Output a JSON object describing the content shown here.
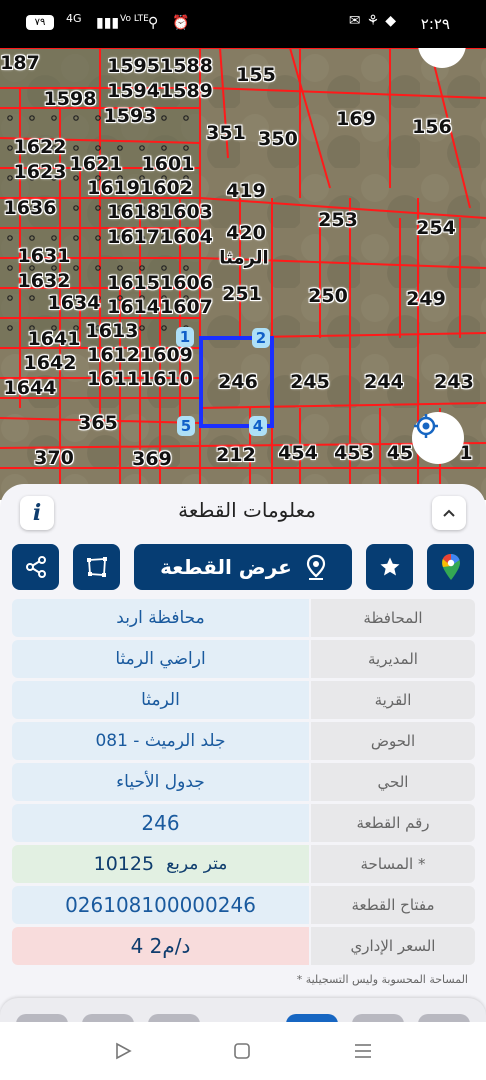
{
  "status_bar": {
    "time": "٢:٢٩",
    "battery": "٧٩",
    "network_top": "4G",
    "network_bottom": "Vo LTE"
  },
  "map": {
    "town_label": "الرمثا",
    "selected_parcel": "246",
    "parcels": [
      {
        "label": "15951588"
      },
      {
        "label": "15941589"
      },
      {
        "label": "1593"
      },
      {
        "label": "1598"
      },
      {
        "label": "1622"
      },
      {
        "label": "1621"
      },
      {
        "label": "1601"
      },
      {
        "label": "1623"
      },
      {
        "label": "16191602"
      },
      {
        "label": "1636"
      },
      {
        "label": "16181603"
      },
      {
        "label": "16171604"
      },
      {
        "label": "1631"
      },
      {
        "label": "1632"
      },
      {
        "label": "16151606"
      },
      {
        "label": "1634"
      },
      {
        "label": "16141607"
      },
      {
        "label": "1613"
      },
      {
        "label": "1641"
      },
      {
        "label": "16121609"
      },
      {
        "label": "1642"
      },
      {
        "label": "16111610"
      },
      {
        "label": "1644"
      },
      {
        "label": "155"
      },
      {
        "label": "169"
      },
      {
        "label": "156"
      },
      {
        "label": "351"
      },
      {
        "label": "350"
      },
      {
        "label": "419"
      },
      {
        "label": "253"
      },
      {
        "label": "254"
      },
      {
        "label": "420"
      },
      {
        "label": "251"
      },
      {
        "label": "250"
      },
      {
        "label": "249"
      },
      {
        "label": "246"
      },
      {
        "label": "245"
      },
      {
        "label": "244"
      },
      {
        "label": "243"
      },
      {
        "label": "365"
      },
      {
        "label": "370"
      },
      {
        "label": "369"
      },
      {
        "label": "212"
      },
      {
        "label": "454"
      },
      {
        "label": "453"
      },
      {
        "label": "45"
      },
      {
        "label": "1"
      },
      {
        "label": "187"
      }
    ],
    "corners": [
      "1",
      "2",
      "4",
      "5"
    ],
    "colors": {
      "boundary": "#ff1a1a",
      "selection": "#1a2fff",
      "corner_bg": "#aee0f7"
    }
  },
  "panel": {
    "title": "معلومات القطعة",
    "view_button_label": "عرض القطعة",
    "rows": [
      {
        "label": "المحافظة",
        "value": "محافظة اربد"
      },
      {
        "label": "المديرية",
        "value": "اراضي الرمثا"
      },
      {
        "label": "القرية",
        "value": "الرمثا"
      },
      {
        "label": "الحوض",
        "value": "جلد الرميث - 081"
      },
      {
        "label": "الحي",
        "value": "جدول الأحياء"
      },
      {
        "label": "رقم القطعة",
        "value": "246"
      },
      {
        "label": "المساحة *",
        "value": "10125",
        "unit": "متر مربع"
      },
      {
        "label": "مفتاح القطعة",
        "value": "026108100000246"
      },
      {
        "label": "السعر الإداري",
        "value": "4 د/م2"
      }
    ],
    "footnote": "* المساحة المحسوبة وليس التسجيلية",
    "colors": {
      "primary": "#063d73",
      "value_blue": "#e3eef7",
      "value_green": "#e2f0e2",
      "value_red": "#f8dcdc"
    }
  },
  "icons": [
    "info-icon",
    "chevron-up-icon",
    "google-maps-icon",
    "star-icon",
    "location-pin-icon",
    "polygon-icon",
    "share-icon",
    "locate-icon",
    "play-icon",
    "square-icon",
    "menu-icon"
  ]
}
